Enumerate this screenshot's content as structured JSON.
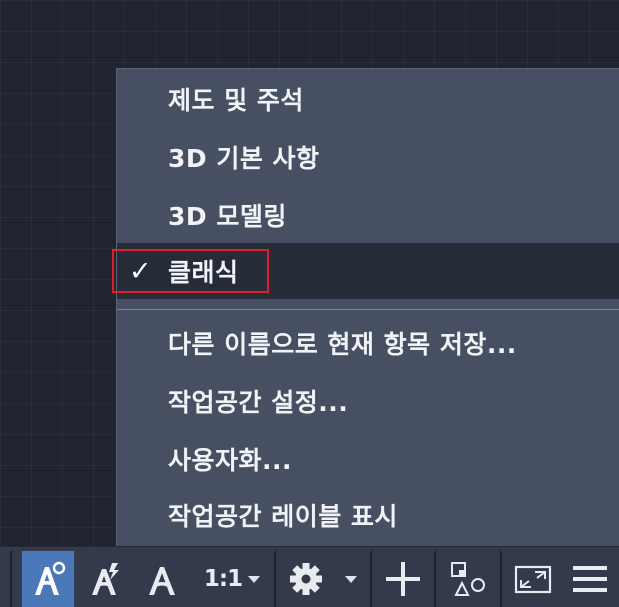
{
  "menu": {
    "items": [
      {
        "label": "제도 및 주석",
        "checked": false
      },
      {
        "label": "3D 기본 사항",
        "checked": false
      },
      {
        "label": "3D 모델링",
        "checked": false
      },
      {
        "label": "클래식",
        "checked": true
      },
      {
        "label": "다른 이름으로 현재 항목 저장...",
        "checked": false
      },
      {
        "label": "작업공간 설정...",
        "checked": false
      },
      {
        "label": "사용자화...",
        "checked": false
      },
      {
        "label": "작업공간 레이블 표시",
        "checked": false
      }
    ],
    "check_glyph": "✓"
  },
  "statusbar": {
    "annotation_scale": "1:1",
    "icons": [
      "annotation-visibility-icon",
      "auto-scale-icon",
      "annotation-object-icon",
      "annotation-scale-dropdown",
      "workspace-switch-gear-icon",
      "workspace-dropdown-caret",
      "annotation-monitor-plus-icon",
      "isolate-objects-icon",
      "fullscreen-icon",
      "customization-menu-icon"
    ],
    "accent_color": "#4a78b8"
  },
  "highlight_color": "#e01f26"
}
